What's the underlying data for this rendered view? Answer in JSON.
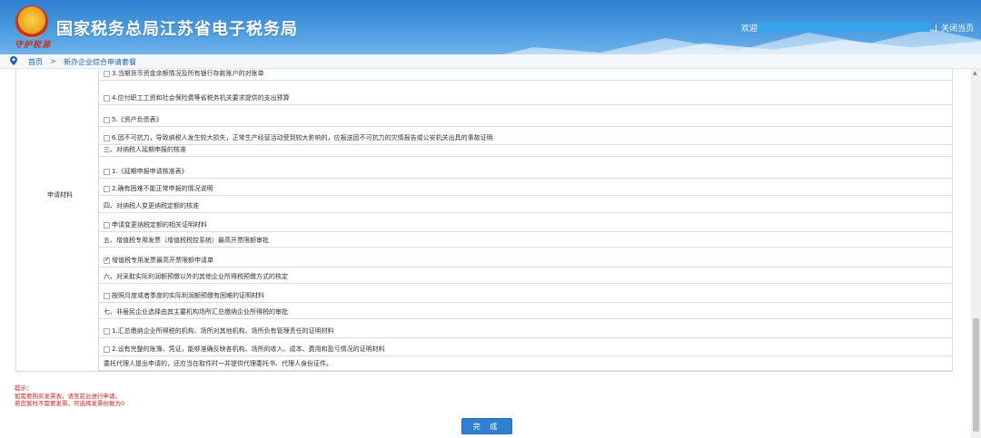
{
  "header": {
    "site_title": "国家税务总局江苏省电子税务局",
    "emblem_script": "守护税源",
    "welcome": "欢迎,",
    "close_current": "关闭当页"
  },
  "breadcrumb": {
    "home": "首页",
    "separator": ">",
    "current": "新办企业综合申请套餐"
  },
  "left_label": "申请材料",
  "rows": [
    {
      "text": "3.当期货币资金余额情况及所有银行存款账户的对账单",
      "checkbox": true,
      "checked": false
    },
    {
      "text": "4.应付职工工资和社会保险费等省税务机关要求提供的支出预算",
      "checkbox": true,
      "checked": false
    },
    {
      "text": "5.《资产负债表》",
      "checkbox": true,
      "checked": false
    },
    {
      "text": "6.因不可抗力，导致纳税人发生较大损失，正常生产经营活动受到较大影响的，应报送因不可抗力的灾情报告或公安机关出具的事故证明",
      "checkbox": true,
      "checked": false
    },
    {
      "text": "三、对纳税人延期申报的核准",
      "checkbox": false,
      "checked": false
    },
    {
      "text": "1.《延期申报申请核准表》",
      "checkbox": true,
      "checked": false
    },
    {
      "text": "2.确有困难不能正常申报的情况说明",
      "checkbox": true,
      "checked": false
    },
    {
      "text": "四、对纳税人变更纳税定额的核准",
      "checkbox": false,
      "checked": false
    },
    {
      "text": "申请变更纳税定额的相关证明材料",
      "checkbox": true,
      "checked": false
    },
    {
      "text": "五、增值税专用发票（增值税税控系统）最高开票限额审批",
      "checkbox": false,
      "checked": false
    },
    {
      "text": "增值税专用发票最高开票限额申请单",
      "checkbox": true,
      "checked": true
    },
    {
      "text": "六、对采取实际利润额预缴以外的其他企业所得税预缴方式的核定",
      "checkbox": false,
      "checked": false
    },
    {
      "text": "按照月度或者季度的实际利润额预缴有困难的证明材料",
      "checkbox": true,
      "checked": false
    },
    {
      "text": "七、非居民企业选择由其主要机构场所汇总缴纳企业所得税的审批",
      "checkbox": false,
      "checked": false
    },
    {
      "text": "1.汇总缴纳企业所得税的机构、场所对其他机构、场所负有管理责任的证明材料",
      "checkbox": true,
      "checked": false
    },
    {
      "text": "2.设有完整的账簿、凭证，能够准确反映各机构、场所的收入、成本、费用和盈亏情况的证明材料",
      "checkbox": true,
      "checked": false
    },
    {
      "text": "委托代理人提出申请的，还应当在取件时一并提供代理委托书、代理人身份证件。",
      "checkbox": false,
      "checked": false
    }
  ],
  "tips": {
    "title": "提示：",
    "line1": "如需要购买发票表，请至前台进行申请。",
    "line2": "若您暂时不需要发票，可选择发票份数为0"
  },
  "finish_button": "完 成",
  "colors": {
    "header_blue": "#2f7fd0",
    "tip_red": "#d02020",
    "button_blue": "#2f80d0"
  }
}
